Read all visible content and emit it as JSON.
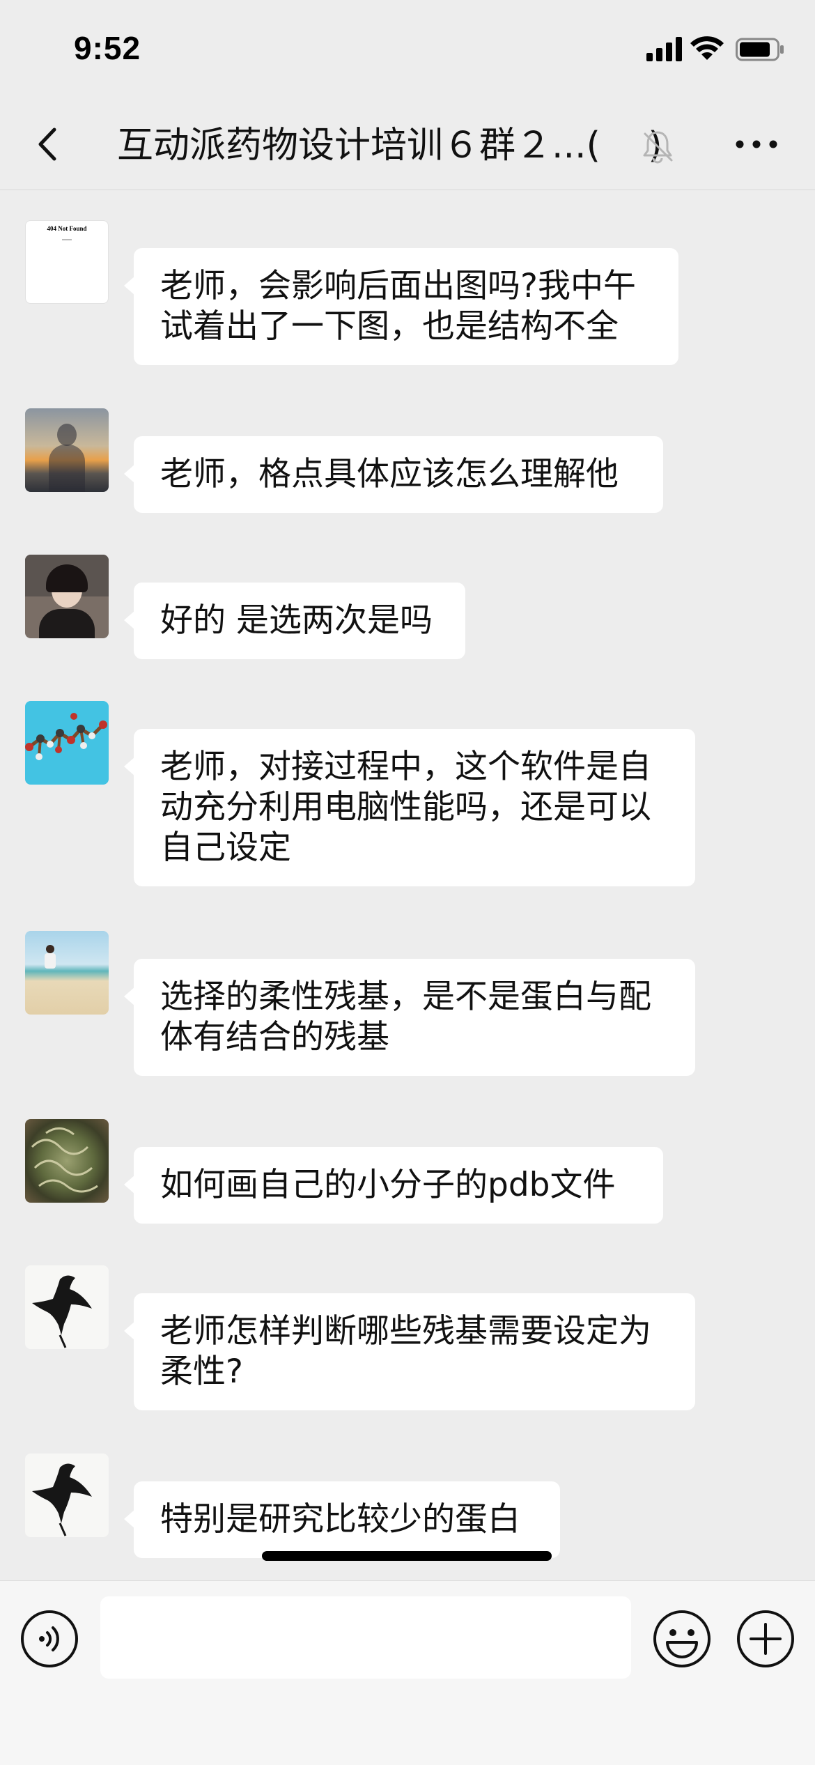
{
  "status_bar": {
    "time": "9:52",
    "icons": [
      "cellular-signal-icon",
      "wifi-icon",
      "battery-icon"
    ]
  },
  "nav_bar": {
    "title": "互动派药物设计培训６群２...(　 )",
    "back_icon": "chevron-left-icon",
    "mute_icon": "bell-muted-icon",
    "more_icon": "ellipsis-icon"
  },
  "messages": [
    {
      "avatar": "404-not-found-image",
      "avatar_text": "404 Not Found",
      "text": "老师，会影响后面出图吗?我中午试着出了一下图，也是结构不全"
    },
    {
      "avatar": "silhouette-sunset-photo",
      "text": "老师，格点具体应该怎么理解他"
    },
    {
      "avatar": "woman-portrait-photo",
      "text": "好的 是选两次是吗"
    },
    {
      "avatar": "molecule-model-image",
      "text": "老师，对接过程中，这个软件是自动充分利用电脑性能吗，还是可以自己设定"
    },
    {
      "avatar": "beach-jump-photo",
      "text": "选择的柔性残基，是不是蛋白与配体有结合的残基"
    },
    {
      "avatar": "green-plant-photo",
      "text": "如何画自己的小分子的pdb文件"
    },
    {
      "avatar": "ink-bird-drawing",
      "text": "老师怎样判断哪些残基需要设定为柔性?"
    },
    {
      "avatar": "ink-bird-drawing",
      "text": "特别是研究比较少的蛋白"
    }
  ],
  "input_bar": {
    "voice_icon": "voice-icon",
    "input_value": "",
    "emoji_icon": "emoji-icon",
    "plus_icon": "plus-circle-icon"
  },
  "colors": {
    "background": "#ededed",
    "bubble": "#ffffff",
    "input_bar": "#f6f6f6",
    "text": "#111111"
  }
}
